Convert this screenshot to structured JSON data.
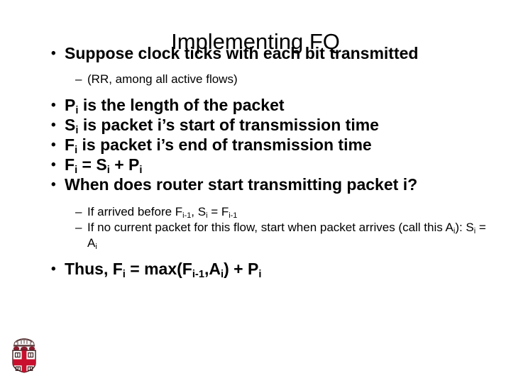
{
  "slide": {
    "title": "Implementing FQ",
    "background_color": "#ffffff",
    "text_color": "#000000"
  },
  "content": [
    {
      "level": 1,
      "marker": "•",
      "runs": [
        {
          "t": "Suppose clock ticks with each bit transmitted"
        }
      ]
    },
    {
      "level": 2,
      "marker": "–",
      "runs": [
        {
          "t": "(RR, among all active flows)"
        }
      ]
    },
    {
      "level": 1,
      "marker": "•",
      "runs": [
        {
          "t": "P"
        },
        {
          "t": "i",
          "sub": true
        },
        {
          "t": " is the length of the packet"
        }
      ]
    },
    {
      "level": 1,
      "marker": "•",
      "runs": [
        {
          "t": "S"
        },
        {
          "t": "i",
          "sub": true
        },
        {
          "t": " is packet i’s start of transmission time"
        }
      ]
    },
    {
      "level": 1,
      "marker": "•",
      "runs": [
        {
          "t": "F"
        },
        {
          "t": "i",
          "sub": true
        },
        {
          "t": " is packet i’s end of transmission time"
        }
      ]
    },
    {
      "level": 1,
      "marker": "•",
      "runs": [
        {
          "t": "F"
        },
        {
          "t": "i",
          "sub": true
        },
        {
          "t": " = S"
        },
        {
          "t": "i",
          "sub": true
        },
        {
          "t": " + P"
        },
        {
          "t": "i",
          "sub": true
        }
      ]
    },
    {
      "level": 1,
      "marker": "•",
      "runs": [
        {
          "t": "When does router start transmitting packet i?"
        }
      ]
    },
    {
      "level": 2,
      "marker": "–",
      "runs": [
        {
          "t": "If arrived before F"
        },
        {
          "t": "i-1",
          "sub": true
        },
        {
          "t": ", S"
        },
        {
          "t": "i",
          "sub": true
        },
        {
          "t": " = F"
        },
        {
          "t": "i-1",
          "sub": true
        }
      ]
    },
    {
      "level": 2,
      "marker": "–",
      "runs": [
        {
          "t": "If no current packet for this flow, start when packet arrives (call this A"
        },
        {
          "t": "i",
          "sub": true
        },
        {
          "t": "): S"
        },
        {
          "t": "i",
          "sub": true
        },
        {
          "t": " = A"
        },
        {
          "t": "i",
          "sub": true
        }
      ]
    },
    {
      "level": 1,
      "marker": "•",
      "runs": [
        {
          "t": "Thus, F"
        },
        {
          "t": "i",
          "sub": true
        },
        {
          "t": " = max(F"
        },
        {
          "t": "i-1",
          "sub": true
        },
        {
          "t": ",A"
        },
        {
          "t": "i",
          "sub": true
        },
        {
          "t": ") + P"
        },
        {
          "t": "i",
          "sub": true
        }
      ]
    }
  ],
  "logo": {
    "name": "brown-university-crest",
    "cross_color": "#c8102e",
    "field_color": "#ffffff",
    "outline_color": "#3d1f1f",
    "crest_color": "#5b3a3a"
  }
}
